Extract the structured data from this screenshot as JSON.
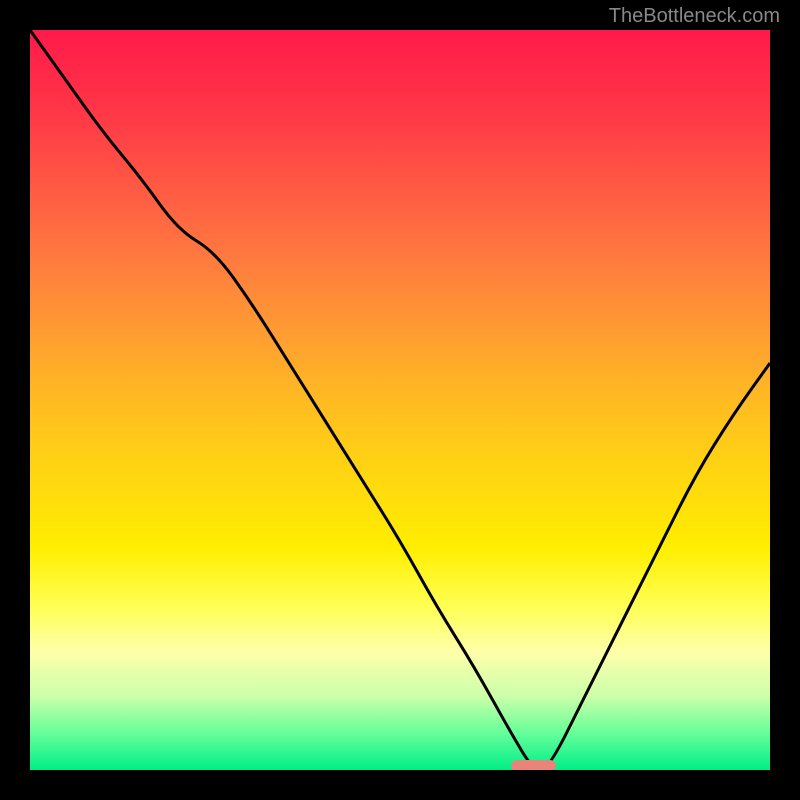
{
  "watermark": "TheBottleneck.com",
  "chart_data": {
    "type": "line",
    "title": "",
    "xlabel": "",
    "ylabel": "",
    "x": [
      0,
      5,
      10,
      15,
      20,
      25,
      30,
      35,
      40,
      45,
      50,
      55,
      60,
      65,
      68,
      70,
      75,
      80,
      85,
      90,
      95,
      100
    ],
    "values": [
      100,
      93,
      86,
      80,
      73,
      70,
      63,
      55,
      47,
      39,
      31,
      22,
      14,
      5,
      0,
      0,
      10,
      20,
      30,
      40,
      48,
      55
    ],
    "xlim": [
      0,
      100
    ],
    "ylim": [
      0,
      100
    ],
    "marker_position": {
      "x": 68,
      "y": 0
    },
    "background_gradient": [
      "#ff1a4a",
      "#ff9933",
      "#ffee00",
      "#00ee88"
    ]
  }
}
